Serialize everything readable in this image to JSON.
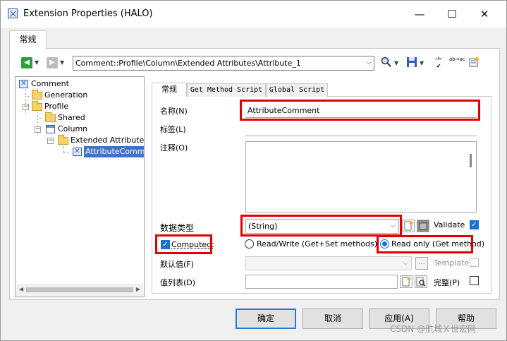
{
  "window": {
    "title": "Extension Properties (HALO)",
    "minimize_glyph": "—",
    "maximize_glyph": "☐",
    "close_glyph": "✕"
  },
  "outer_tab": "常规",
  "toolbar": {
    "path": "Comment::Profile\\Column\\Extended Attributes\\Attribute_1",
    "icons": [
      "back-arrow-icon",
      "forward-arrow-icon",
      "find-icon",
      "save-icon",
      "spell-check-icon",
      "replace-icon",
      "properties-icon"
    ],
    "spell_glyph": "ᴬᴮᶜ",
    "replace_glyph": "ab→ac"
  },
  "tree": {
    "items": [
      {
        "label": "Comment",
        "icon": "extension-icon"
      },
      {
        "label": "Generation",
        "icon": "folder-icon"
      },
      {
        "label": "Profile",
        "icon": "folder-icon"
      },
      {
        "label": "Shared",
        "icon": "folder-icon"
      },
      {
        "label": "Column",
        "icon": "table-icon"
      },
      {
        "label": "Extended Attributes",
        "icon": "folder-icon"
      },
      {
        "label": "AttributeComment",
        "icon": "extended-attribute-icon"
      }
    ]
  },
  "tabs": [
    {
      "label": "常规"
    },
    {
      "label": "Get Method Script"
    },
    {
      "label": "Global Script"
    }
  ],
  "form": {
    "name_label": "名称(N)",
    "name_value": "AttributeComment",
    "label_label": "标签(L)",
    "label_value": "",
    "comment_label": "注释(O)",
    "comment_value": "",
    "datatype_label": "数据类型",
    "datatype_value": "(String)",
    "validate_label": "Validate",
    "validate_checked": true,
    "computed_label": "Computed:",
    "computed_checked": true,
    "rw_option": "Read/Write (Get+Set methods)",
    "ro_option": "Read only (Get method)",
    "selected_option": "read_only",
    "default_label": "默认值(F)",
    "default_value": "",
    "browse_glyph": "...",
    "template_label": "Template",
    "template_checked": false,
    "values_label": "值列表(D)",
    "values_value": "",
    "complete_label": "完整(P)",
    "complete_checked": false
  },
  "buttons": {
    "ok": "确定",
    "cancel": "取消",
    "apply": "应用(A)",
    "help": "帮助"
  },
  "watermark": "CSDN @航城Ｘ世宏网",
  "colors": {
    "highlight": "#e00000",
    "accent": "#1a6fd0",
    "selection": "#3f73c8"
  }
}
